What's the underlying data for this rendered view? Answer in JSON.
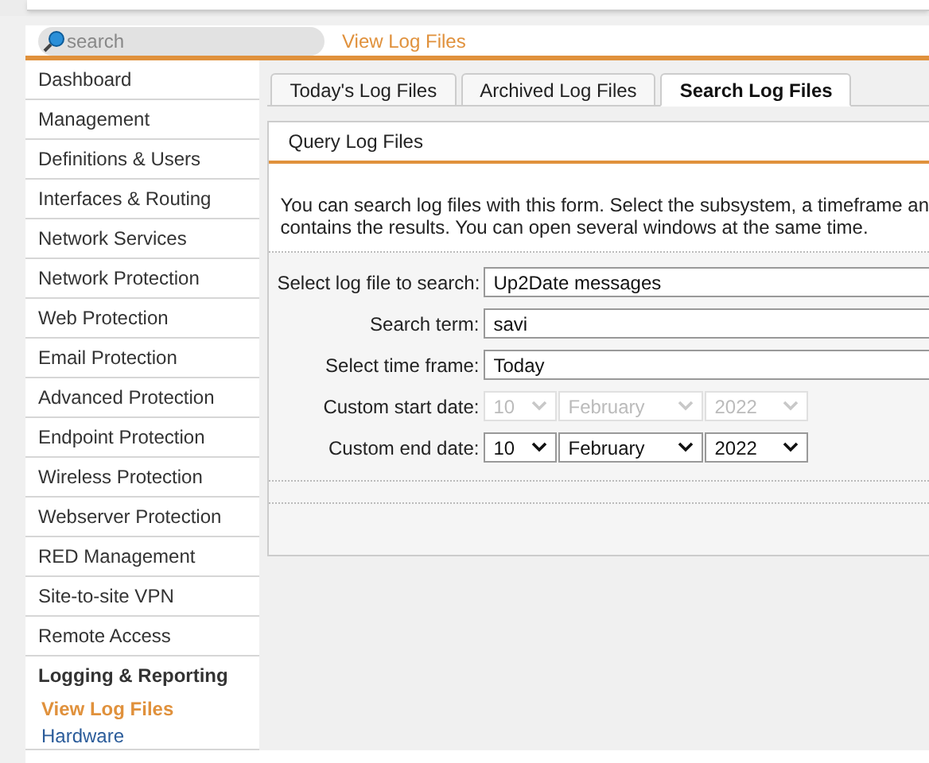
{
  "search": {
    "placeholder": "search"
  },
  "breadcrumb": "View Log Files",
  "sidebar": {
    "items": [
      {
        "label": "Dashboard",
        "expanded": false
      },
      {
        "label": "Management",
        "expanded": false
      },
      {
        "label": "Definitions & Users",
        "expanded": false
      },
      {
        "label": "Interfaces & Routing",
        "expanded": false
      },
      {
        "label": "Network Services",
        "expanded": false
      },
      {
        "label": "Network Protection",
        "expanded": false
      },
      {
        "label": "Web Protection",
        "expanded": false
      },
      {
        "label": "Email Protection",
        "expanded": false
      },
      {
        "label": "Advanced Protection",
        "expanded": false
      },
      {
        "label": "Endpoint Protection",
        "expanded": false
      },
      {
        "label": "Wireless Protection",
        "expanded": false
      },
      {
        "label": "Webserver Protection",
        "expanded": false
      },
      {
        "label": "RED Management",
        "expanded": false
      },
      {
        "label": "Site-to-site VPN",
        "expanded": false
      },
      {
        "label": "Remote Access",
        "expanded": false
      },
      {
        "label": "Logging & Reporting",
        "expanded": true,
        "children": [
          {
            "label": "View Log Files",
            "selected": true
          },
          {
            "label": "Hardware",
            "selected": false
          }
        ]
      }
    ]
  },
  "tabs": [
    {
      "label": "Today's Log Files",
      "selected": false
    },
    {
      "label": "Archived Log Files",
      "selected": false
    },
    {
      "label": "Search Log Files",
      "selected": true
    }
  ],
  "panel": {
    "title": "Query Log Files",
    "description": "You can search log files with this form. Select the subsystem, a timeframe an",
    "description_line_2": "contains the results. You can open several windows at the same time.",
    "fields": [
      {
        "kind": "select",
        "label": "Select log file to search:",
        "value": "Up2Date messages"
      },
      {
        "kind": "text",
        "label": "Search term:",
        "value": "savi"
      },
      {
        "kind": "select",
        "label": "Select time frame:",
        "value": "Today"
      },
      {
        "kind": "date",
        "label": "Custom start date:",
        "disabled": true,
        "day": "10",
        "month": "February",
        "year": "2022"
      },
      {
        "kind": "date",
        "label": "Custom end date:",
        "disabled": false,
        "day": "10",
        "month": "February",
        "year": "2022"
      }
    ]
  }
}
